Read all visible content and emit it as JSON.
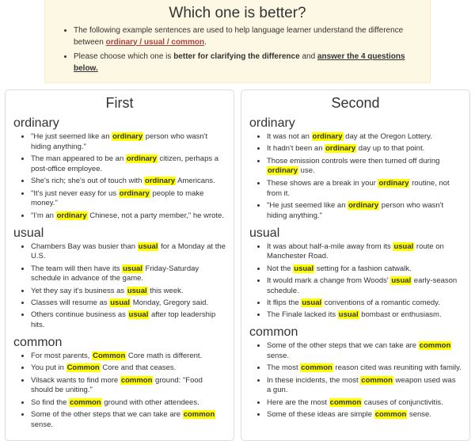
{
  "intro": {
    "title": "Which one is better?",
    "line1_pre": "The following example sentences are used to help language learner understand the difference between ",
    "line1_link": "ordinary / usual / common",
    "line1_post": ".",
    "line2_pre": "Please choose which one is ",
    "line2_bold": "better for clarifying the difference",
    "line2_mid": " and ",
    "line2_link": "answer the 4 questions below."
  },
  "options": [
    {
      "title": "First",
      "words": [
        {
          "label": "ordinary",
          "sentences": [
            [
              [
                "\"He just seemed like an "
              ],
              [
                "hl",
                "ordinary"
              ],
              [
                " person who wasn't hiding anything.\""
              ]
            ],
            [
              [
                "The man appeared to be an "
              ],
              [
                "hl",
                "ordinary"
              ],
              [
                " citizen, perhaps a post-office employee."
              ]
            ],
            [
              [
                "She's rich; she's out of touch with "
              ],
              [
                "hl",
                "ordinary"
              ],
              [
                " Americans."
              ]
            ],
            [
              [
                "\"It's just never easy for us "
              ],
              [
                "hl",
                "ordinary"
              ],
              [
                " people to make money.\""
              ]
            ],
            [
              [
                "\"I'm an "
              ],
              [
                "hl",
                "ordinary"
              ],
              [
                " Chinese, not a party member,\" he wrote."
              ]
            ]
          ]
        },
        {
          "label": "usual",
          "sentences": [
            [
              [
                "Chambers Bay was busier than "
              ],
              [
                "hl",
                "usual"
              ],
              [
                " for a Monday at the U.S."
              ]
            ],
            [
              [
                "The team will then have its "
              ],
              [
                "hl",
                "usual"
              ],
              [
                " Friday-Saturday schedule in advance of the game."
              ]
            ],
            [
              [
                "Yet they say it's business as "
              ],
              [
                "hl",
                "usual"
              ],
              [
                " this week."
              ]
            ],
            [
              [
                "Classes will resume as "
              ],
              [
                "hl",
                "usual"
              ],
              [
                " Monday, Gregory said."
              ]
            ],
            [
              [
                "Others continue business as "
              ],
              [
                "hl",
                "usual"
              ],
              [
                " after top leadership hits."
              ]
            ]
          ]
        },
        {
          "label": "common",
          "sentences": [
            [
              [
                "For most parents, "
              ],
              [
                "hl",
                "Common"
              ],
              [
                " Core math is different."
              ]
            ],
            [
              [
                "You put in "
              ],
              [
                "hl",
                "Common"
              ],
              [
                " Core and that ceases."
              ]
            ],
            [
              [
                "Vilsack wants to find more "
              ],
              [
                "hl",
                "common"
              ],
              [
                " ground: \"Food should be uniting.\""
              ]
            ],
            [
              [
                "So find the "
              ],
              [
                "hl",
                "common"
              ],
              [
                " ground with other attendees."
              ]
            ],
            [
              [
                "Some of the other steps that we can take are "
              ],
              [
                "hl",
                "common"
              ],
              [
                " sense."
              ]
            ]
          ]
        }
      ]
    },
    {
      "title": "Second",
      "words": [
        {
          "label": "ordinary",
          "sentences": [
            [
              [
                "It was not an "
              ],
              [
                "hl",
                "ordinary"
              ],
              [
                " day at the Oregon Lottery."
              ]
            ],
            [
              [
                "It hadn't been an "
              ],
              [
                "hl",
                "ordinary"
              ],
              [
                " day up to that point."
              ]
            ],
            [
              [
                "Those emission controls were then turned off during "
              ],
              [
                "hl",
                "ordinary"
              ],
              [
                " use."
              ]
            ],
            [
              [
                "These shows are a break in your "
              ],
              [
                "hl",
                "ordinary"
              ],
              [
                " routine, not from it."
              ]
            ],
            [
              [
                "\"He just seemed like an "
              ],
              [
                "hl",
                "ordinary"
              ],
              [
                " person who wasn't hiding anything.\""
              ]
            ]
          ]
        },
        {
          "label": "usual",
          "sentences": [
            [
              [
                "It was about half-a-mile away from its "
              ],
              [
                "hl",
                "usual"
              ],
              [
                " route on Manchester Road."
              ]
            ],
            [
              [
                "Not the "
              ],
              [
                "hl",
                "usual"
              ],
              [
                " setting for a fashion catwalk."
              ]
            ],
            [
              [
                "It would mark a change from Woods' "
              ],
              [
                "hl",
                "usual"
              ],
              [
                " early-season schedule."
              ]
            ],
            [
              [
                "It flips the "
              ],
              [
                "hl",
                "usual"
              ],
              [
                " conventions of a romantic comedy."
              ]
            ],
            [
              [
                "The Finale lacked its "
              ],
              [
                "hl",
                "usual"
              ],
              [
                " bombast or enthusiasm."
              ]
            ]
          ]
        },
        {
          "label": "common",
          "sentences": [
            [
              [
                "Some of the other steps that we can take are "
              ],
              [
                "hl",
                "common"
              ],
              [
                " sense."
              ]
            ],
            [
              [
                "The most "
              ],
              [
                "hl",
                "common"
              ],
              [
                " reason cited was reuniting with family."
              ]
            ],
            [
              [
                "In these incidents, the most "
              ],
              [
                "hl",
                "common"
              ],
              [
                " weapon used was a gun."
              ]
            ],
            [
              [
                "Here are the most "
              ],
              [
                "hl",
                "common"
              ],
              [
                " causes of conjunctivitis."
              ]
            ],
            [
              [
                "Some of these ideas are simple "
              ],
              [
                "hl",
                "common"
              ],
              [
                " sense."
              ]
            ]
          ]
        }
      ]
    }
  ]
}
